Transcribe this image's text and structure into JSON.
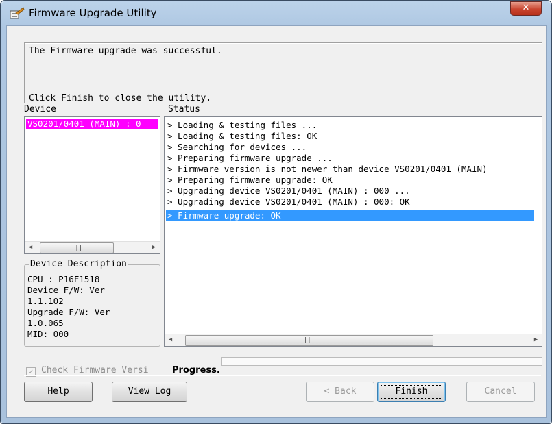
{
  "window": {
    "title": "Firmware Upgrade Utility",
    "close_icon": "close-icon"
  },
  "message": {
    "line1": "The Firmware upgrade was successful.",
    "line2": "Click Finish to close the utility."
  },
  "device": {
    "label": "Device",
    "items": [
      "VS0201/0401 (MAIN) : 0"
    ],
    "selected_color": "#ff00ff"
  },
  "status": {
    "label": "Status",
    "lines": [
      "> Loading & testing files ...",
      "> Loading & testing files: OK",
      "> Searching for devices ...",
      "> Preparing firmware upgrade ...",
      "> Firmware version is not newer than device VS0201/0401 (MAIN)",
      "> Preparing firmware upgrade: OK",
      "> Upgrading device VS0201/0401 (MAIN) : 000 ...",
      "> Upgrading device VS0201/0401 (MAIN) : 000: OK",
      "> Firmware upgrade: OK"
    ],
    "selected_index": 8,
    "selected_color": "#3399ff"
  },
  "description": {
    "title": "Device Description",
    "lines": [
      "CPU : P16F1518",
      "Device F/W: Ver",
      "1.1.102",
      "Upgrade F/W: Ver",
      "1.0.065",
      "MID: 000"
    ]
  },
  "options": {
    "check_firmware_label": "Check Firmware Versi",
    "checked": true
  },
  "progress": {
    "label": "Progress.",
    "value": 0
  },
  "buttons": {
    "help": "Help",
    "view_log": "View Log",
    "back": "< Back",
    "finish": "Finish",
    "cancel": "Cancel"
  }
}
